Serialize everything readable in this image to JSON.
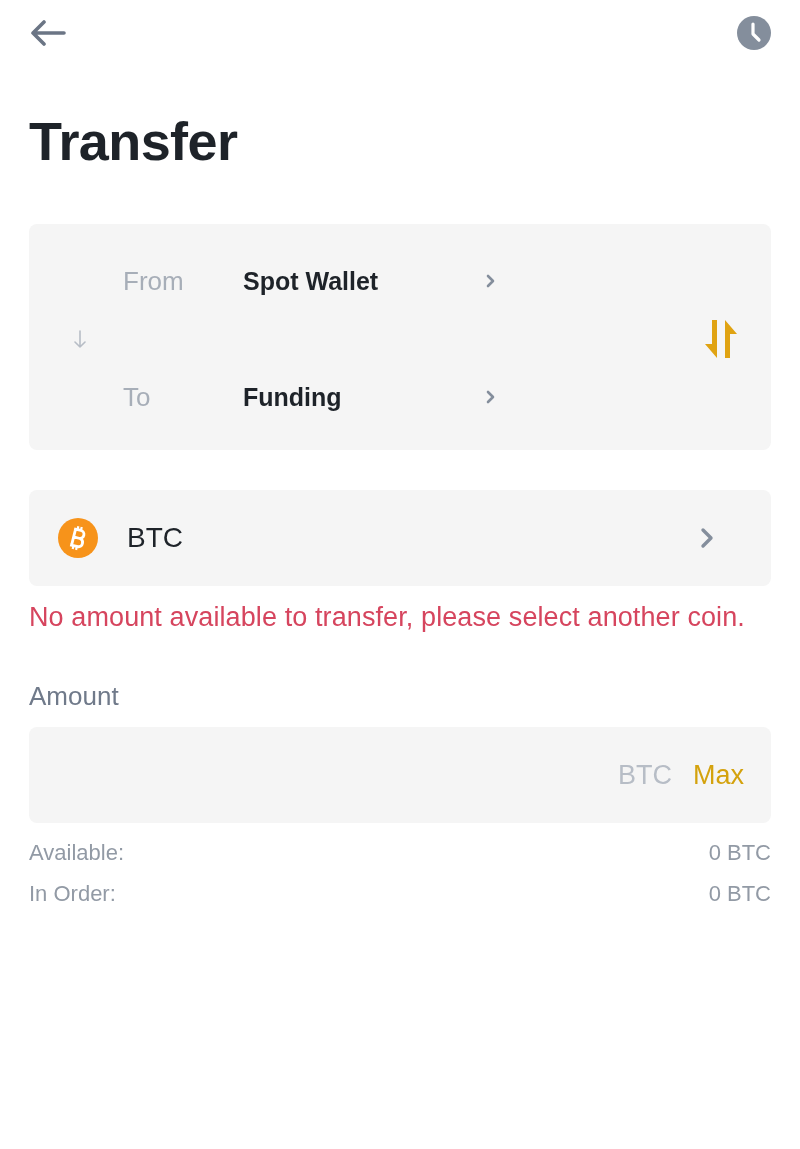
{
  "header": {
    "title": "Transfer"
  },
  "route": [
    {
      "label": "From",
      "wallet": "Spot Wallet"
    },
    {
      "label": "To",
      "wallet": "Funding"
    }
  ],
  "coin": {
    "symbol": "BTC"
  },
  "error_message": "No amount available to transfer, please select another coin.",
  "amount": {
    "label": "Amount",
    "unit": "BTC",
    "max_button": "Max"
  },
  "balances": [
    {
      "label": "Available:",
      "value": "0 BTC"
    },
    {
      "label": "In Order:",
      "value": "0 BTC"
    }
  ]
}
